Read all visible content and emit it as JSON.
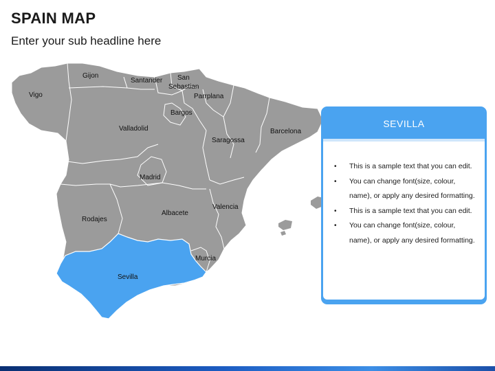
{
  "title": "SPAIN MAP",
  "subtitle": "Enter your sub headline here",
  "colors": {
    "region": "#9b9b9b",
    "highlight": "#4aa3f0",
    "accent": "#4aa3f0"
  },
  "map": {
    "highlighted_region": "Sevilla",
    "labels": {
      "vigo": "Vigo",
      "gijon": "Gijon",
      "santander": "Santander",
      "san": "San",
      "sebastian": "Sebastian",
      "parrplana": "Parrplana",
      "bargos": "Bargos",
      "valladolid": "Valladolid",
      "saragossa": "Saragossa",
      "barcelona": "Barcelona",
      "madrid": "Madrid",
      "rodajes": "Rodajes",
      "albacete": "Albacete",
      "valencia": "Valencia",
      "murcia": "Murcia",
      "sevilla": "Sevilla"
    }
  },
  "callout": {
    "title": "SEVILLA",
    "items": [
      "This is a sample text that you can edit.",
      "You can change font(size, colour, name), or apply any desired formatting.",
      "This is a sample text that you can edit.",
      "You can change font(size, colour, name), or apply any desired formatting."
    ]
  }
}
